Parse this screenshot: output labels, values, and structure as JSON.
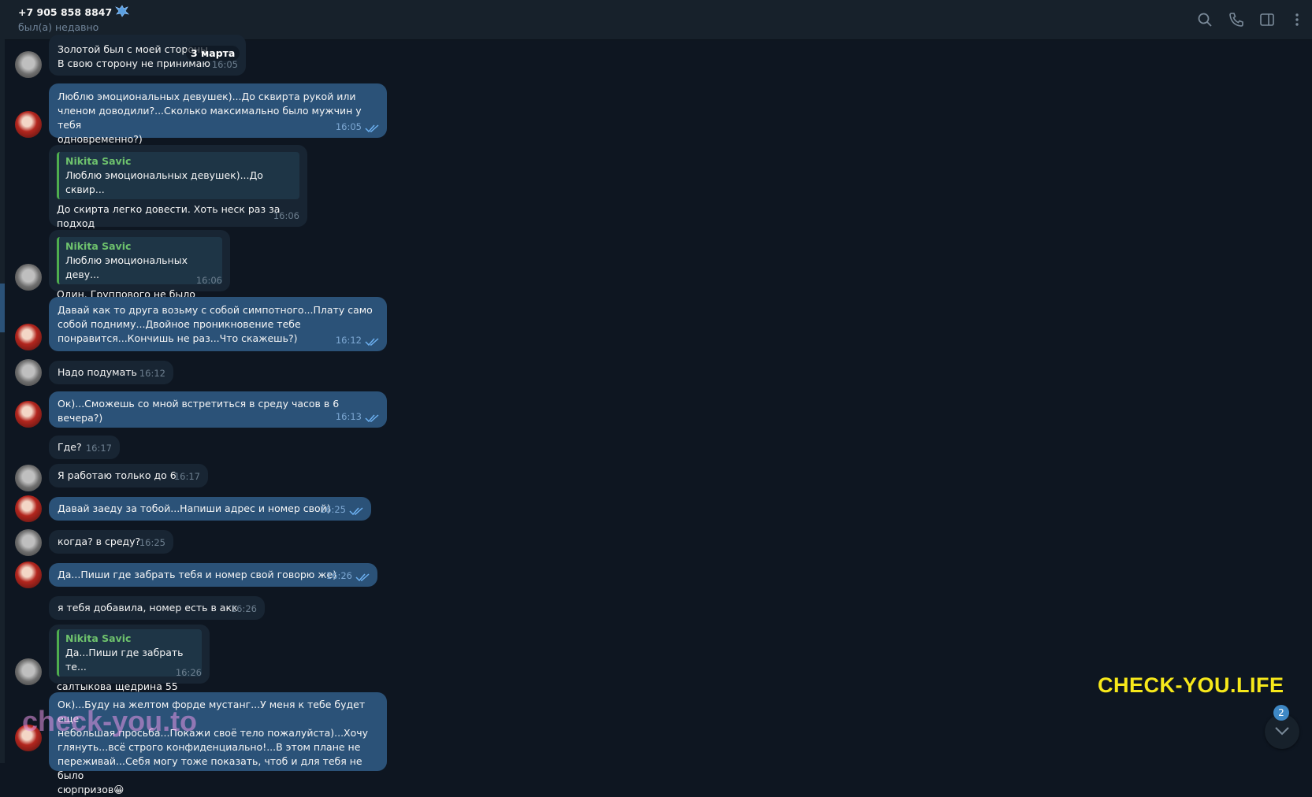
{
  "header": {
    "title": "+7 905 858 8847",
    "status": "был(а) недавно"
  },
  "date_pill": "3 марта",
  "reply_author": "Nikita Savic",
  "messages": [
    {
      "text": "Золотой был с моей стороны\nВ свою сторону не принимаю",
      "time": "16:05"
    },
    {
      "text": "Люблю эмоциональных девушек)...До сквирта рукой или\nчленом доводили?...Сколько максимально было мужчин у тебя\nодновременно?)",
      "time": "16:05"
    },
    {
      "reply": "Люблю эмоциональных девушек)...До сквир...",
      "text": "До скирта легко довести. Хоть неск раз за подход",
      "time": "16:06",
      "reaction": "🔥"
    },
    {
      "reply": "Люблю эмоциональных деву...",
      "text": "Один. Группового не было",
      "time": "16:06"
    },
    {
      "text": "Давай как то друга возьму с собой симпотного...Плату само\nсобой подниму...Двойное проникновение тебе\nпонравится...Кончишь не раз...Что скажешь?)",
      "time": "16:12"
    },
    {
      "text": "Надо подумать",
      "time": "16:12"
    },
    {
      "text": "Ок)...Сможешь со мной встретиться в среду часов в 6 вечера?)",
      "time": "16:13"
    },
    {
      "text": "Где?",
      "time": "16:17"
    },
    {
      "text": "Я работаю только до 6",
      "time": "16:17"
    },
    {
      "text": "Давай заеду за тобой...Напиши адрес и номер свой)",
      "time": "16:25"
    },
    {
      "text": "когда? в среду?",
      "time": "16:25"
    },
    {
      "text": "Да...Пиши где забрать тебя и номер свой говорю же)",
      "time": "16:26"
    },
    {
      "text": "я тебя добавила, номер есть в акк",
      "time": "16:26"
    },
    {
      "reply": "Да...Пиши где забрать те...",
      "text": "салтыкова щедрина 55",
      "time": "16:26"
    },
    {
      "text": "Ок)...Буду на желтом форде мустанг...У меня к тебе будет еще\nнебольшая просьба...Покажи своё тело пожалуйста)...Хочу\nглянуть...всё строго конфиденциально!...В этом плане не\nпереживай...Себя могу тоже показать, чтоб и для тебя не было\nсюрпризов😀"
    }
  ],
  "scroll_down": {
    "unread_count": "2"
  },
  "watermarks": {
    "top": "CHECK-YOU.LIFE",
    "bottom": "check-you.to"
  },
  "colors": {
    "background": "#0e1621",
    "header": "#17212b",
    "incoming_bubble": "#182533",
    "outgoing_bubble": "#2b5278",
    "reply_accent": "#4fae4e",
    "watermark_yellow": "#f7e81a"
  },
  "icons": [
    "search-icon",
    "phone-icon",
    "sidebar-toggle-icon",
    "more-vertical-icon",
    "chevron-down-icon",
    "double-check-icon"
  ]
}
